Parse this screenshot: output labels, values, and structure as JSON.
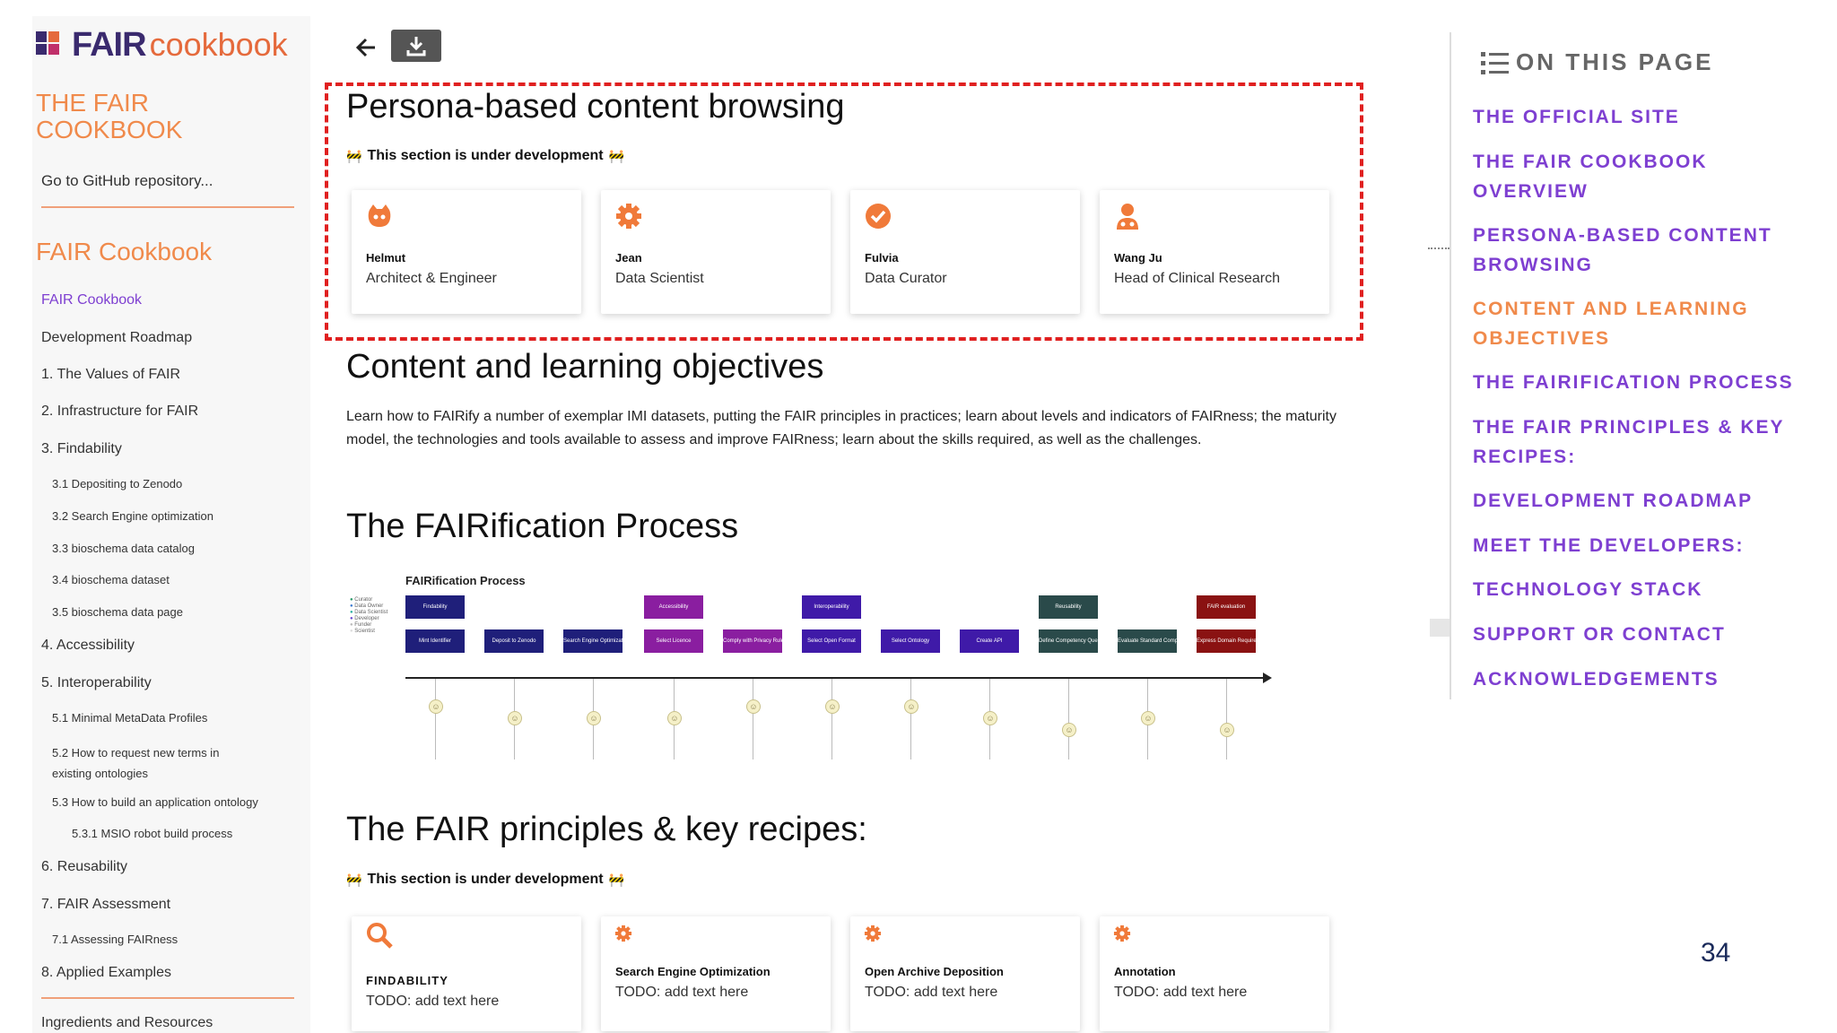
{
  "sidebar": {
    "logo": {
      "fair": "FAIR",
      "cookbook": "cookbook"
    },
    "title_line1": "THE FAIR",
    "title_line2": "COOKBOOK",
    "github_link": "Go to GitHub repository...",
    "section_title": "FAIR Cookbook",
    "items": [
      {
        "label": "FAIR Cookbook",
        "level": 0,
        "active": true
      },
      {
        "label": "Development Roadmap",
        "level": 0
      },
      {
        "label": "1. The Values of FAIR",
        "level": 0
      },
      {
        "label": "2. Infrastructure for FAIR",
        "level": 0
      },
      {
        "label": "3. Findability",
        "level": 0
      },
      {
        "label": "3.1 Depositing to Zenodo",
        "level": 1
      },
      {
        "label": "3.2 Search Engine optimization",
        "level": 1
      },
      {
        "label": "3.3 bioschema data catalog",
        "level": 1
      },
      {
        "label": "3.4 bioschema dataset",
        "level": 1
      },
      {
        "label": "3.5 bioschema data page",
        "level": 1
      },
      {
        "label": "4. Accessibility",
        "level": 0
      },
      {
        "label": "5. Interoperability",
        "level": 0
      },
      {
        "label": "5.1 Minimal MetaData Profiles",
        "level": 1
      },
      {
        "label": "5.2 How to request new terms in",
        "label2": "existing ontologies",
        "level": 1
      },
      {
        "label": "5.3 How to build an application ontology",
        "level": 1
      },
      {
        "label": "5.3.1 MSIO robot build process",
        "level": 2
      },
      {
        "label": "6. Reusability",
        "level": 0
      },
      {
        "label": "7. FAIR Assessment",
        "level": 0
      },
      {
        "label": "7.1 Assessing FAIRness",
        "level": 1
      },
      {
        "label": "8. Applied Examples",
        "level": 0
      },
      {
        "label": "Ingredients and Resources",
        "level": 0
      }
    ]
  },
  "toolbar": {
    "back_icon": "arrow-left-icon",
    "download_icon": "download-icon"
  },
  "persona": {
    "heading": "Persona-based content browsing",
    "dev_note": "This section is under development",
    "cards": [
      {
        "name": "Helmut",
        "role": "Architect & Engineer",
        "icon": "github-icon"
      },
      {
        "name": "Jean",
        "role": "Data Scientist",
        "icon": "gear-icon"
      },
      {
        "name": "Fulvia",
        "role": "Data Curator",
        "icon": "check-circle-icon"
      },
      {
        "name": "Wang Ju",
        "role": "Head of Clinical Research",
        "icon": "doctor-icon"
      }
    ]
  },
  "content": {
    "heading": "Content and learning objectives",
    "paragraph": "Learn how to FAIRify a number of exemplar IMI datasets, putting the FAIR principles in practices; learn about levels and indicators of FAIRness; the maturity model, the technologies and tools available to assess and improve FAIRness; learn about the skills required, as well as the challenges."
  },
  "fairification": {
    "heading": "The FAIRification Process",
    "diagram_title": "FAIRification Process",
    "legend": [
      "Curator",
      "Data Owner",
      "Data Scientist",
      "Developer",
      "Funder",
      "Scientist"
    ],
    "top_boxes": [
      "Findability",
      "Accessibility",
      "Interoperability",
      "Reusability",
      "FAIR evaluation"
    ],
    "steps": [
      "Mint Identifier",
      "Deposit to Zenodo",
      "Search Engine Optimization",
      "Select Licence",
      "Comply with Privacy Rules",
      "Select Open Format",
      "Select Ontology",
      "Create API",
      "Define Competency Questions",
      "Evaluate Standard Compliance",
      "Express Domain Requirements"
    ],
    "colors": {
      "findability": "#1f1f7a",
      "accessibility": "#8a1ea0",
      "interoperability": "#3f1aa8",
      "reusability": "#2a4a4a",
      "evaluation": "#8a1212"
    }
  },
  "principles": {
    "heading": "The FAIR principles & key recipes:",
    "dev_note": "This section is under development",
    "cards": [
      {
        "name": "FINDABILITY",
        "text": "TODO: add text here",
        "icon": "search-icon"
      },
      {
        "name": "Search Engine Optimization",
        "text": "TODO: add text here",
        "icon": "gear-icon"
      },
      {
        "name": "Open Archive Deposition",
        "text": "TODO: add text here",
        "icon": "gear-icon"
      },
      {
        "name": "Annotation",
        "text": "TODO: add text here",
        "icon": "gear-icon"
      }
    ]
  },
  "toc": {
    "heading": "ON THIS PAGE",
    "items": [
      {
        "line1": "THE OFFICIAL SITE"
      },
      {
        "line1": "THE FAIR COOKBOOK",
        "line2": "OVERVIEW"
      },
      {
        "line1": "PERSONA-BASED CONTENT",
        "line2": "BROWSING"
      },
      {
        "line1": "CONTENT AND LEARNING",
        "line2": "OBJECTIVES",
        "active": true
      },
      {
        "line1": "THE FAIRIFICATION PROCESS"
      },
      {
        "line1": "THE FAIR PRINCIPLES & KEY",
        "line2": "RECIPES:"
      },
      {
        "line1": "DEVELOPMENT ROADMAP"
      },
      {
        "line1": "MEET THE DEVELOPERS:"
      },
      {
        "line1": "TECHNOLOGY STACK"
      },
      {
        "line1": "SUPPORT OR CONTACT"
      },
      {
        "line1": "ACKNOWLEDGEMENTS"
      }
    ]
  },
  "page_number": "34",
  "colors": {
    "accent": "#f08a4b",
    "purple": "#7e3fd1",
    "highlight_border": "#e02020"
  }
}
